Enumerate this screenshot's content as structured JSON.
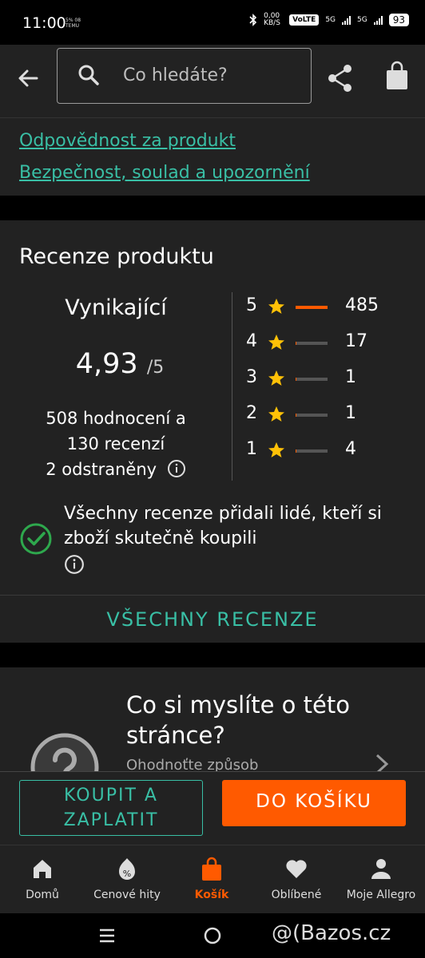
{
  "status_bar": {
    "time": "11:00",
    "tiny_info": "5% 08 TEMU",
    "speed": "0,00 KB/S",
    "volte": "VoLTE",
    "net1": "5G",
    "net2": "5G",
    "battery": "93"
  },
  "header": {
    "search_placeholder": "Co hledáte?",
    "icons": [
      "arrow-back-icon",
      "search-icon",
      "share-icon",
      "bag-icon"
    ]
  },
  "links": {
    "responsibility": "Odpovědnost za produkt",
    "safety": "Bezpečnost, soulad a upozornění"
  },
  "reviews": {
    "title": "Recenze produktu",
    "verdict": "Vynikající",
    "score": "4,93",
    "score_max": "/5",
    "ratings_line": "508 hodnocení a",
    "reviews_line": "130 recenzí",
    "removed_line": "2 odstraněny",
    "distribution": [
      {
        "stars": "5",
        "count": "485",
        "fraction": 1.0
      },
      {
        "stars": "4",
        "count": "17",
        "fraction": 0.035
      },
      {
        "stars": "3",
        "count": "1",
        "fraction": 0.002
      },
      {
        "stars": "2",
        "count": "1",
        "fraction": 0.002
      },
      {
        "stars": "1",
        "count": "4",
        "fraction": 0.008
      }
    ],
    "verified_text": "Všechny recenze přidali lidé, kteří si zboží skutečně koupili",
    "all_reviews_button": "VŠECHNY RECENZE",
    "accent_color": "#39bfa5",
    "star_color": "#ffc107",
    "bar_color": "#ff5a00"
  },
  "feedback": {
    "question": "Co si myslíte o této stránce?",
    "subtitle": "Ohodnoťte způsob"
  },
  "buy_bar": {
    "buy_now": "KOUPIT A ZAPLATIT",
    "add_to_cart": "DO KOŠÍKU"
  },
  "bottom_nav": [
    {
      "label": "Domů",
      "icon": "home-icon",
      "active": false
    },
    {
      "label": "Cenové hity",
      "icon": "price-tag-icon",
      "active": false
    },
    {
      "label": "Košík",
      "icon": "cart-bag-icon",
      "active": true
    },
    {
      "label": "Oblíbené",
      "icon": "heart-icon",
      "active": false
    },
    {
      "label": "Moje Allegro",
      "icon": "person-icon",
      "active": false
    }
  ],
  "watermark": "@(Bazos.cz"
}
